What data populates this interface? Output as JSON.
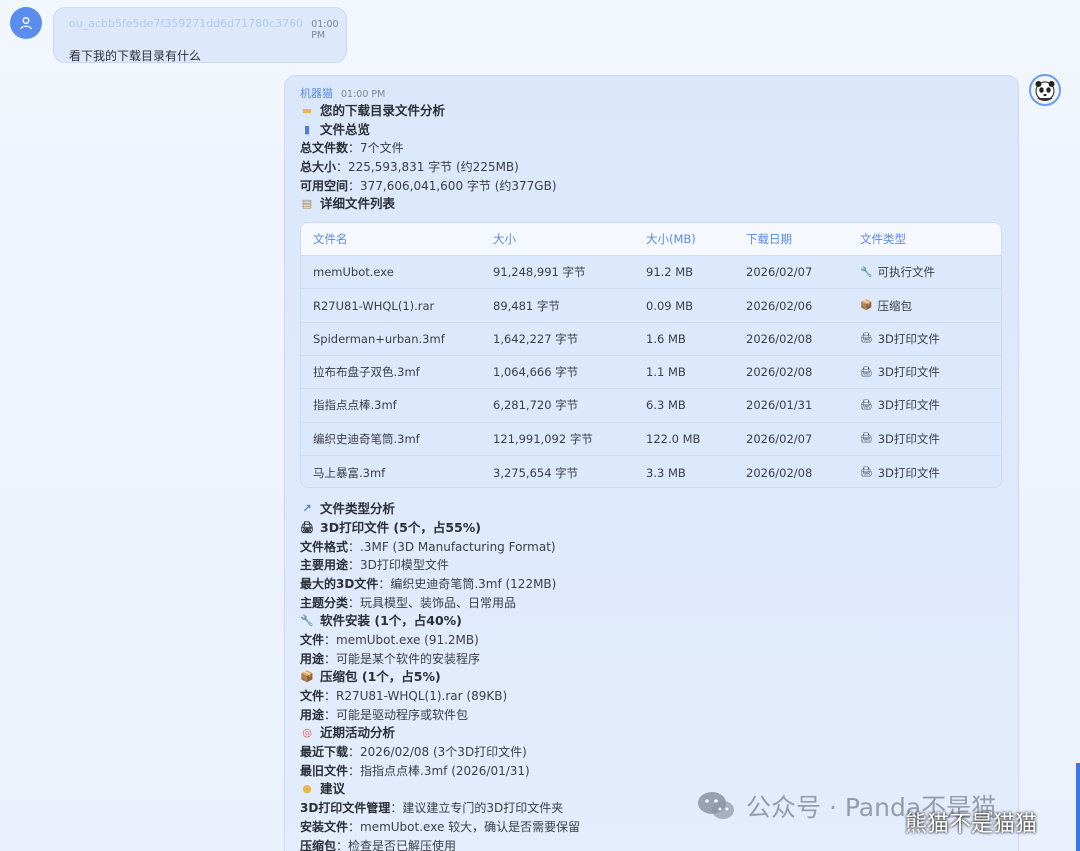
{
  "user_message": {
    "name": "ou_acbb5fe5de7f359271dd6d71780c3760",
    "time": "01:00 PM",
    "text": "看下我的下载目录有什么"
  },
  "bot_message": {
    "name": "机器猫",
    "time": "01:00 PM",
    "title": "您的下载目录文件分析",
    "overview": {
      "heading": "文件总览",
      "items": [
        {
          "label": "总文件数",
          "value": "：7个文件"
        },
        {
          "label": "总大小",
          "value": "：225,593,831 字节 (约225MB)"
        },
        {
          "label": "可用空间",
          "value": "：377,606,041,600 字节 (约377GB)"
        }
      ]
    },
    "list_heading": "详细文件列表",
    "table": {
      "headers": [
        "文件名",
        "大小",
        "大小(MB)",
        "下载日期",
        "文件类型"
      ],
      "rows": [
        {
          "name": "memUbot.exe",
          "size": "91,248,991 字节",
          "mb": "91.2 MB",
          "date": "2026/02/07",
          "type": "可执行文件",
          "icon": "🔧"
        },
        {
          "name": "R27U81-WHQL(1).rar",
          "size": "89,481 字节",
          "mb": "0.09 MB",
          "date": "2026/02/06",
          "type": "压缩包",
          "icon": "📦"
        },
        {
          "name": "Spiderman+urban.3mf",
          "size": "1,642,227 字节",
          "mb": "1.6 MB",
          "date": "2026/02/08",
          "type": "3D打印文件",
          "icon": "🖨"
        },
        {
          "name": "拉布布盘子双色.3mf",
          "size": "1,064,666 字节",
          "mb": "1.1 MB",
          "date": "2026/02/08",
          "type": "3D打印文件",
          "icon": "🖨"
        },
        {
          "name": "指指点点棒.3mf",
          "size": "6,281,720 字节",
          "mb": "6.3 MB",
          "date": "2026/01/31",
          "type": "3D打印文件",
          "icon": "🖨"
        },
        {
          "name": "编织史迪奇笔筒.3mf",
          "size": "121,991,092 字节",
          "mb": "122.0 MB",
          "date": "2026/02/07",
          "type": "3D打印文件",
          "icon": "🖨"
        },
        {
          "name": "马上暴富.3mf",
          "size": "3,275,654 字节",
          "mb": "3.3 MB",
          "date": "2026/02/08",
          "type": "3D打印文件",
          "icon": "🖨"
        }
      ]
    },
    "type_analysis": {
      "heading": "文件类型分析",
      "print3d": {
        "heading": "3D打印文件 (5个，占55%)",
        "items": [
          {
            "label": "文件格式",
            "value": "：.3MF (3D Manufacturing Format)"
          },
          {
            "label": "主要用途",
            "value": "：3D打印模型文件"
          },
          {
            "label": "最大的3D文件",
            "value": "：编织史迪奇笔筒.3mf (122MB)"
          },
          {
            "label": "主题分类",
            "value": "：玩具模型、装饰品、日常用品"
          }
        ]
      },
      "software": {
        "heading": "软件安装 (1个，占40%)",
        "items": [
          {
            "label": "文件",
            "value": "：memUbot.exe (91.2MB)"
          },
          {
            "label": "用途",
            "value": "：可能是某个软件的安装程序"
          }
        ]
      },
      "archive": {
        "heading": "压缩包 (1个，占5%)",
        "items": [
          {
            "label": "文件",
            "value": "：R27U81-WHQL(1).rar (89KB)"
          },
          {
            "label": "用途",
            "value": "：可能是驱动程序或软件包"
          }
        ]
      }
    },
    "activity": {
      "heading": "近期活动分析",
      "items": [
        {
          "label": "最近下载",
          "value": "：2026/02/08 (3个3D打印文件)"
        },
        {
          "label": "最旧文件",
          "value": "：指指点点棒.3mf (2026/01/31)"
        }
      ]
    },
    "suggestions": {
      "heading": "建议",
      "items": [
        {
          "label": "3D打印文件管理",
          "value": "：建议建立专门的3D打印文件夹"
        },
        {
          "label": "安装文件",
          "value": "：memUbot.exe 较大，确认是否需要保留"
        },
        {
          "label": "压缩包",
          "value": "：检查是否已解压使用"
        }
      ]
    }
  },
  "watermark": {
    "text": "公众号 · Panda不是猫",
    "overlay": "熊猫不是猫猫"
  }
}
